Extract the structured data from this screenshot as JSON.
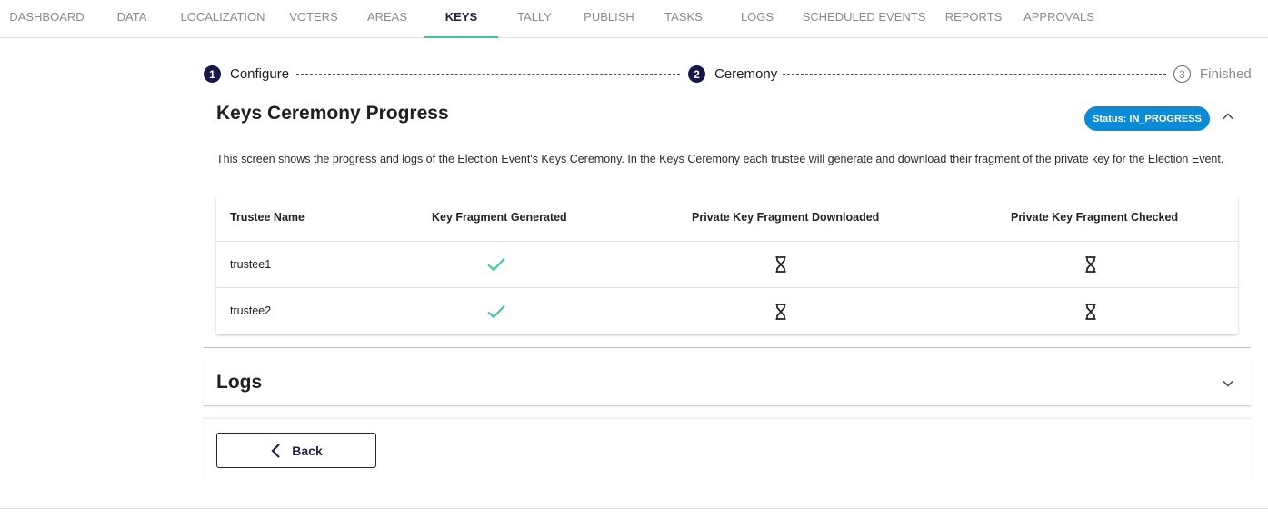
{
  "tabs": [
    {
      "label": "DASHBOARD",
      "active": false
    },
    {
      "label": "DATA",
      "active": false
    },
    {
      "label": "LOCALIZATION",
      "active": false
    },
    {
      "label": "VOTERS",
      "active": false
    },
    {
      "label": "AREAS",
      "active": false
    },
    {
      "label": "KEYS",
      "active": true
    },
    {
      "label": "TALLY",
      "active": false
    },
    {
      "label": "PUBLISH",
      "active": false
    },
    {
      "label": "TASKS",
      "active": false
    },
    {
      "label": "LOGS",
      "active": false
    },
    {
      "label": "SCHEDULED EVENTS",
      "active": false
    },
    {
      "label": "REPORTS",
      "active": false
    },
    {
      "label": "APPROVALS",
      "active": false
    }
  ],
  "stepper": {
    "steps": [
      {
        "number": "1",
        "label": "Configure",
        "state": "done"
      },
      {
        "number": "2",
        "label": "Ceremony",
        "state": "done"
      },
      {
        "number": "3",
        "label": "Finished",
        "state": "todo"
      }
    ]
  },
  "progress": {
    "title": "Keys Ceremony Progress",
    "status_badge": "Status: IN_PROGRESS",
    "description": "This screen shows the progress and logs of the Election Event's Keys Ceremony. In the Keys Ceremony each trustee will generate and download their fragment of the private key for the Election Event.",
    "table": {
      "columns": [
        "Trustee Name",
        "Key Fragment Generated",
        "Private Key Fragment Downloaded",
        "Private Key Fragment Checked"
      ],
      "rows": [
        {
          "name": "trustee1",
          "generated": "check-icon",
          "downloaded": "hourglass-icon",
          "checked": "hourglass-icon"
        },
        {
          "name": "trustee2",
          "generated": "check-icon",
          "downloaded": "hourglass-icon",
          "checked": "hourglass-icon"
        }
      ]
    }
  },
  "logs": {
    "title": "Logs"
  },
  "actions": {
    "back_label": "Back"
  },
  "colors": {
    "accent": "#43c2a4",
    "primary": "#151848",
    "status": "#0b8ad6",
    "check": "#43c2a4"
  }
}
